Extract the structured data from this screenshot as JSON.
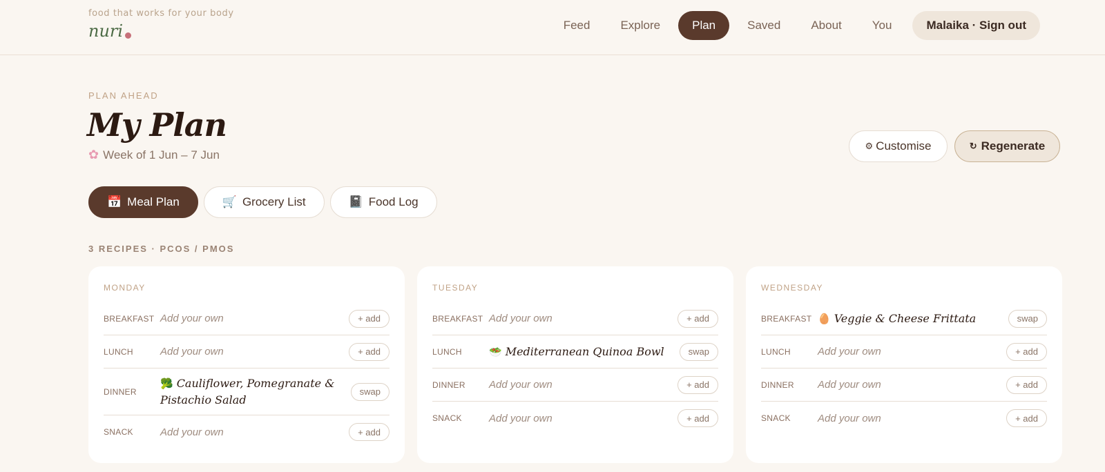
{
  "brand": {
    "tagline": "food that works for your body",
    "logo": "nuri"
  },
  "nav": {
    "items": [
      "Feed",
      "Explore",
      "Plan",
      "Saved",
      "About",
      "You"
    ],
    "active": "Plan",
    "account": "Malaika · Sign out"
  },
  "header": {
    "eyebrow": "PLAN AHEAD",
    "title": "My Plan",
    "week_icon": "flower-icon",
    "week": "Week of 1 Jun – 7 Jun"
  },
  "actions": {
    "customise": "Customise",
    "customise_icon": "gear-icon",
    "regenerate": "Regenerate",
    "regenerate_icon": "refresh-icon"
  },
  "tabs": [
    {
      "label": "Meal Plan",
      "icon": "calendar-icon",
      "active": true
    },
    {
      "label": "Grocery List",
      "icon": "cart-icon",
      "active": false
    },
    {
      "label": "Food Log",
      "icon": "notebook-icon",
      "active": false
    }
  ],
  "recipes_meta": "3 RECIPES · PCOS / PMOS",
  "days": [
    {
      "name": "MONDAY",
      "meals": [
        {
          "type": "BREAKFAST",
          "value": "Add your own",
          "action": "+ add",
          "recipe": false
        },
        {
          "type": "LUNCH",
          "value": "Add your own",
          "action": "+ add",
          "recipe": false
        },
        {
          "type": "DINNER",
          "value": "Cauliflower, Pomegranate & Pistachio Salad",
          "icon": "broccoli-icon",
          "action": "swap",
          "recipe": true
        },
        {
          "type": "SNACK",
          "value": "Add your own",
          "action": "+ add",
          "recipe": false
        }
      ]
    },
    {
      "name": "TUESDAY",
      "meals": [
        {
          "type": "BREAKFAST",
          "value": "Add your own",
          "action": "+ add",
          "recipe": false
        },
        {
          "type": "LUNCH",
          "value": "Mediterranean Quinoa Bowl",
          "icon": "salad-icon",
          "action": "swap",
          "recipe": true
        },
        {
          "type": "DINNER",
          "value": "Add your own",
          "action": "+ add",
          "recipe": false
        },
        {
          "type": "SNACK",
          "value": "Add your own",
          "action": "+ add",
          "recipe": false
        }
      ]
    },
    {
      "name": "WEDNESDAY",
      "meals": [
        {
          "type": "BREAKFAST",
          "value": "Veggie & Cheese Frittata",
          "icon": "egg-icon",
          "action": "swap",
          "recipe": true
        },
        {
          "type": "LUNCH",
          "value": "Add your own",
          "action": "+ add",
          "recipe": false
        },
        {
          "type": "DINNER",
          "value": "Add your own",
          "action": "+ add",
          "recipe": false
        },
        {
          "type": "SNACK",
          "value": "Add your own",
          "action": "+ add",
          "recipe": false
        }
      ]
    }
  ],
  "colors": {
    "accent": "#5a3a2c",
    "background": "#faf6f1",
    "brand_green": "#4c6b45",
    "brand_dot": "#c7707a"
  }
}
